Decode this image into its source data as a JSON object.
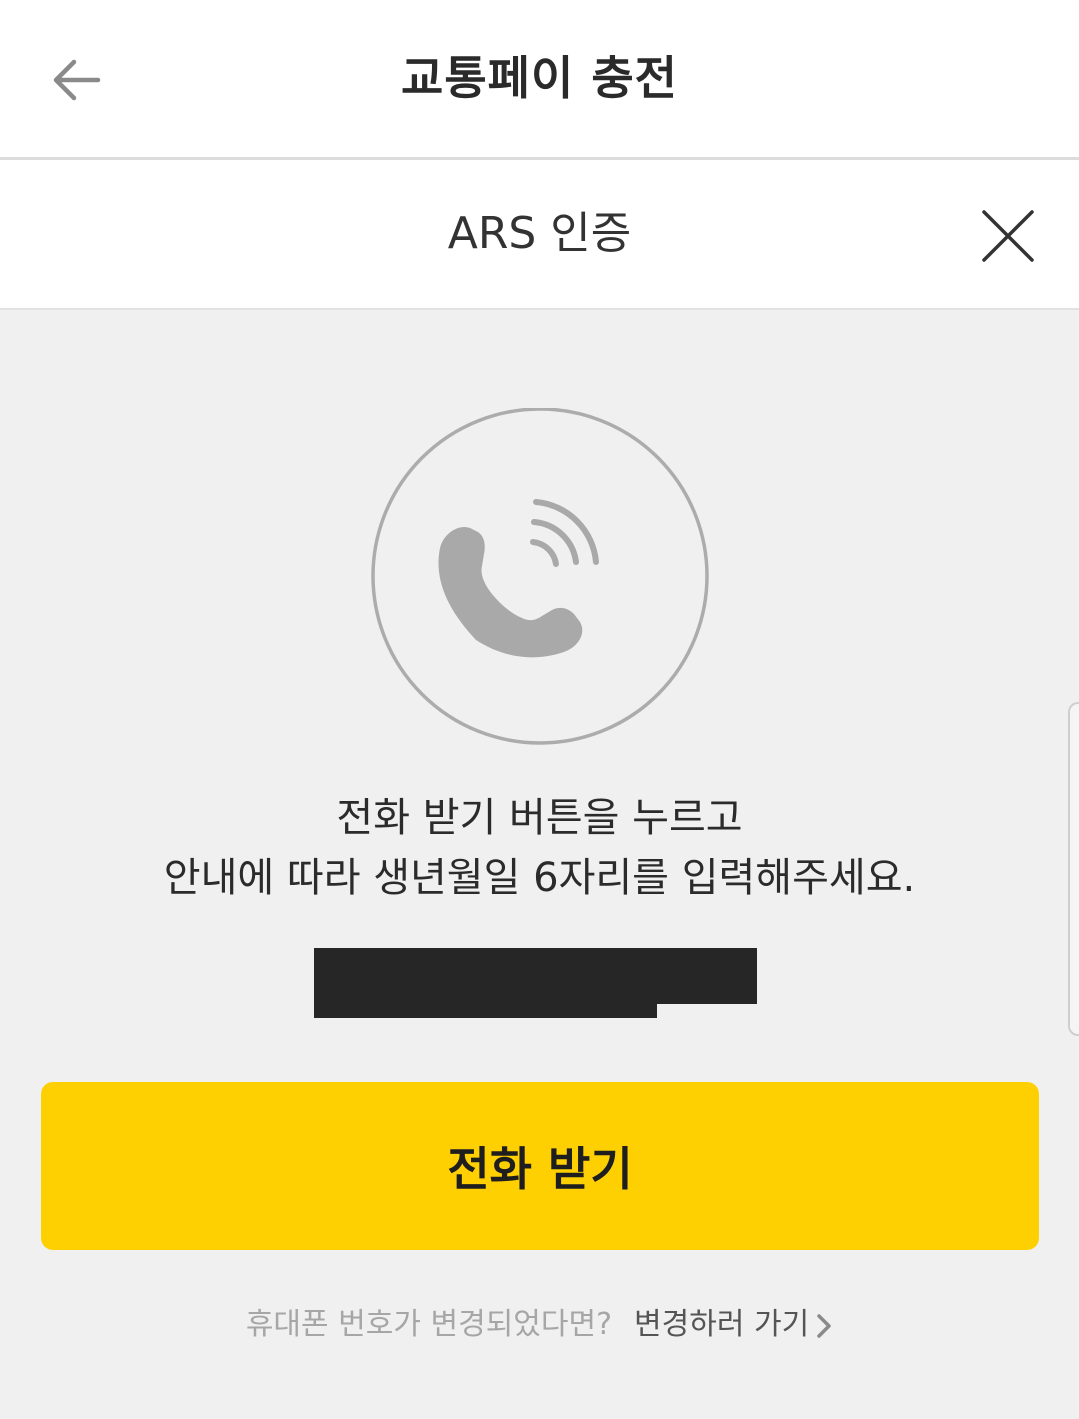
{
  "header": {
    "title": "교통페이 충전",
    "back_icon": "back-arrow-icon"
  },
  "modal": {
    "title": "ARS 인증",
    "close_icon": "close-icon"
  },
  "illustration": {
    "icon": "phone-call-icon"
  },
  "instructions": {
    "line1": "전화 받기 버튼을 누르고",
    "line2": "안내에 따라 생년월일 6자리를 입력해주세요."
  },
  "primary_button": {
    "label": "전화 받기",
    "color": "#fed002"
  },
  "footer": {
    "question": "휴대폰 번호가 변경되었다면?",
    "link_label": "변경하러 가기",
    "link_icon": "chevron-right-icon"
  },
  "colors": {
    "accent": "#fed002",
    "background": "#f0f0f0",
    "icon_gray": "#a8a8a8"
  }
}
